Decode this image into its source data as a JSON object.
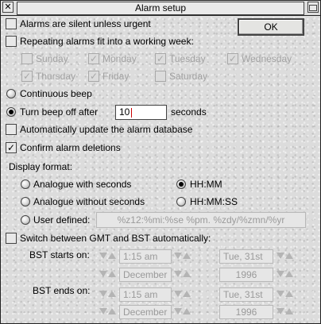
{
  "window": {
    "title": "Alarm setup",
    "close_glyph": "✕",
    "toggle_glyph": ""
  },
  "ok_label": "OK",
  "options": {
    "silent_unless_urgent": {
      "label": "Alarms are silent unless urgent",
      "checked": false
    },
    "working_week": {
      "label": "Repeating alarms fit into a working week:",
      "checked": false
    },
    "continuous_beep": {
      "label": "Continuous beep"
    },
    "beep_off_after": {
      "label": "Turn beep off after",
      "value": "10",
      "unit": "seconds"
    },
    "auto_update_db": {
      "label": "Automatically update the alarm database",
      "checked": false
    },
    "confirm_deletions": {
      "label": "Confirm alarm deletions",
      "checked": true
    },
    "switch_gmt_bst": {
      "label": "Switch between GMT and BST automatically:",
      "checked": false
    }
  },
  "days": {
    "sunday": {
      "label": "Sunday",
      "checked": false
    },
    "monday": {
      "label": "Monday",
      "checked": true
    },
    "tuesday": {
      "label": "Tuesday",
      "checked": true
    },
    "wednesday": {
      "label": "Wednesday",
      "checked": true
    },
    "thursday": {
      "label": "Thursday",
      "checked": true
    },
    "friday": {
      "label": "Friday",
      "checked": true
    },
    "saturday": {
      "label": "Saturday",
      "checked": false
    }
  },
  "display_format": {
    "label": "Display format:",
    "analogue_with_seconds": "Analogue with seconds",
    "analogue_without_seconds": "Analogue without seconds",
    "user_defined": "User defined:",
    "hhmm": "HH:MM",
    "hhmmss": "HH:MM:SS",
    "selected": "HH:MM",
    "user_defined_value": "%z12:%mi:%se %pm. %zdy/%zmn/%yr"
  },
  "bst": {
    "starts_label": "BST starts on:",
    "ends_label": "BST ends on:",
    "starts": {
      "time": "1:15 am",
      "day": "Tue, 31st",
      "month": "December",
      "year": "1996"
    },
    "ends": {
      "time": "1:15 am",
      "day": "Tue, 31st",
      "month": "December",
      "year": "1996"
    }
  },
  "glyphs": {
    "tick": "✓"
  },
  "icons": [
    "close-icon",
    "toggle-size-icon",
    "tick-icon",
    "radio-icon",
    "down-arrow-icon",
    "up-arrow-icon"
  ]
}
